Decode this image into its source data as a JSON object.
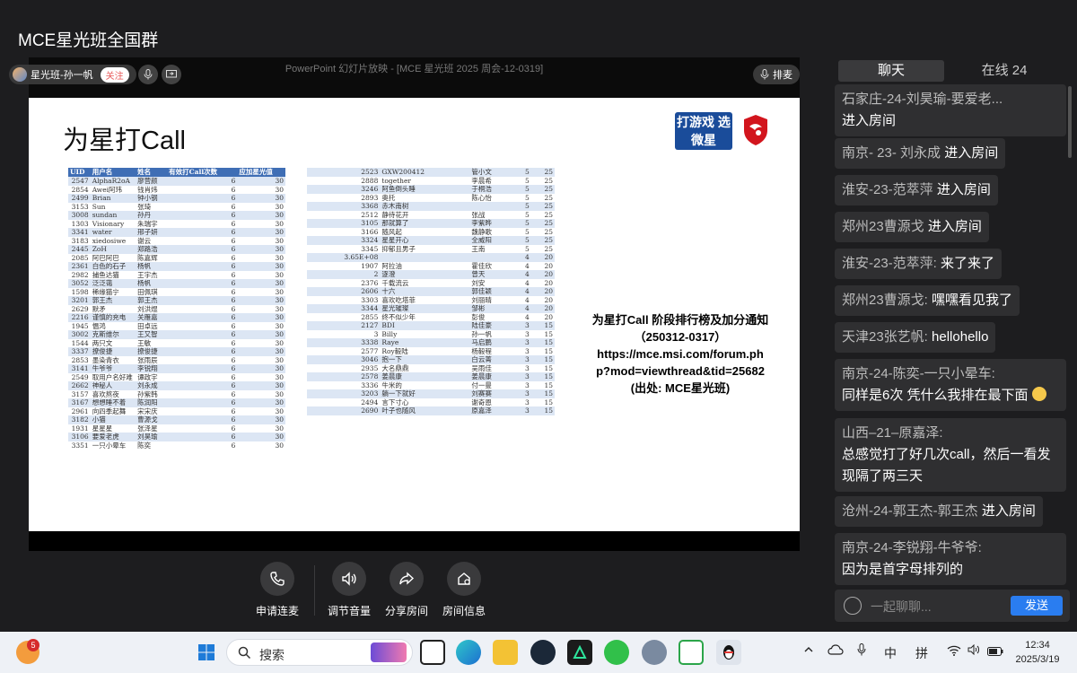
{
  "window": {
    "title": "MCE星光班全国群"
  },
  "stage": {
    "ppt_title": "PowerPoint 幻灯片放映 - [MCE 星光班 2025 周会-12-0319]",
    "host_name": "星光班-孙一帆",
    "follow_label": "关注",
    "queue_label": "排麦"
  },
  "slide": {
    "title": "为星打Call",
    "logo_text": "打游戏 选微星",
    "notice_lines": [
      "为星打Call 阶段排行榜及加分通知",
      "（250312-0317）",
      "https://mce.msi.com/forum.ph",
      "p?mod=viewthread&tid=25682",
      "(出处: MCE星光班)"
    ],
    "left_table": {
      "headers": [
        "UID",
        "用户名",
        "姓名",
        "有效打Call次数",
        "应加星光值"
      ],
      "rows": [
        [
          "2547",
          "AlphaR2oA",
          "廖营颜",
          "6",
          "30"
        ],
        [
          "2854",
          "Awei阿玮",
          "钱肖炜",
          "6",
          "30"
        ],
        [
          "2499",
          "Brian",
          "钟小钢",
          "6",
          "30"
        ],
        [
          "3153",
          "Sun",
          "张琦",
          "6",
          "30"
        ],
        [
          "3008",
          "sundan",
          "孙丹",
          "6",
          "30"
        ],
        [
          "1303",
          "Visionary",
          "朱瑞宇",
          "6",
          "30"
        ],
        [
          "3341",
          "water",
          "邢子妍",
          "6",
          "30"
        ],
        [
          "3183",
          "xiedosiwe",
          "谢云",
          "6",
          "30"
        ],
        [
          "2445",
          "ZoH",
          "郑路浩",
          "6",
          "30"
        ],
        [
          "2085",
          "阿巴阿巴",
          "陈嘉辉",
          "6",
          "30"
        ],
        [
          "2361",
          "白色的石子",
          "杨帆",
          "6",
          "30"
        ],
        [
          "2982",
          "捕鱼达猫",
          "王宇杰",
          "6",
          "30"
        ],
        [
          "3052",
          "泛泛蔼",
          "杨帆",
          "6",
          "30"
        ],
        [
          "1598",
          "稀缘猫宁",
          "田佩琪",
          "6",
          "30"
        ],
        [
          "3201",
          "郭王杰",
          "郭王杰",
          "6",
          "30"
        ],
        [
          "2629",
          "默矛",
          "刘洪煜",
          "6",
          "30"
        ],
        [
          "2216",
          "谨慎的充电",
          "关雁嘉",
          "6",
          "30"
        ],
        [
          "1945",
          "愠鸿",
          "田卓远",
          "6",
          "30"
        ],
        [
          "3002",
          "克斯维尔",
          "王又智",
          "6",
          "30"
        ],
        [
          "1544",
          "两只文",
          "王敏",
          "6",
          "30"
        ],
        [
          "3337",
          "撩俊捷",
          "撩俊捷",
          "6",
          "30"
        ],
        [
          "2853",
          "墨染青衣",
          "张雨辰",
          "6",
          "30"
        ],
        [
          "3141",
          "牛爷爷",
          "李锐翔",
          "6",
          "30"
        ],
        [
          "2549",
          "取用户名好难",
          "谭政宇",
          "6",
          "30"
        ],
        [
          "2662",
          "神秘人",
          "刘永成",
          "6",
          "30"
        ],
        [
          "3157",
          "喜欢熬夜",
          "孙紫韩",
          "6",
          "30"
        ],
        [
          "3167",
          "想想睡不着",
          "陈润阳",
          "6",
          "30"
        ],
        [
          "2961",
          "向四季起舞",
          "宋宋庆",
          "6",
          "30"
        ],
        [
          "3182",
          "小猫",
          "曹源戈",
          "6",
          "30"
        ],
        [
          "1931",
          "星星星",
          "张泽星",
          "6",
          "30"
        ],
        [
          "3106",
          "要爱老虎",
          "刘昊瑜",
          "6",
          "30"
        ],
        [
          "3351",
          "一只小晕车",
          "陈奕",
          "6",
          "30"
        ]
      ]
    },
    "right_table": {
      "rows": [
        [
          "2523",
          "GXW200412",
          "管小文",
          "5",
          "25"
        ],
        [
          "2888",
          "together",
          "李晨希",
          "5",
          "25"
        ],
        [
          "3246",
          "阿鱼倒头睡",
          "于桐浩",
          "5",
          "25"
        ],
        [
          "2893",
          "奥托",
          "陈心怡",
          "5",
          "25"
        ],
        [
          "3368",
          "赤木南树",
          "",
          "5",
          "25"
        ],
        [
          "2512",
          "静待花开",
          "张战",
          "5",
          "25"
        ],
        [
          "3105",
          "那就算了",
          "李紫晔",
          "5",
          "25"
        ],
        [
          "3166",
          "随风起",
          "魏静歌",
          "5",
          "25"
        ],
        [
          "3324",
          "星星开心",
          "全威阳",
          "5",
          "25"
        ],
        [
          "3345",
          "抑郁且男子",
          "王南",
          "5",
          "25"
        ],
        [
          "3.65E+08",
          "",
          "",
          "4",
          "20"
        ],
        [
          "1907",
          "阿拉油",
          "霍佳欣",
          "4",
          "20"
        ],
        [
          "2",
          "逐澄",
          "曾天",
          "4",
          "20"
        ],
        [
          "2376",
          "千载流云",
          "刘安",
          "4",
          "20"
        ],
        [
          "2606",
          "十六",
          "郭佳颖",
          "4",
          "20"
        ],
        [
          "3303",
          "喜欢吃塔菲",
          "刘丽晴",
          "4",
          "20"
        ],
        [
          "3344",
          "星光璀璨",
          "邹彬",
          "4",
          "20"
        ],
        [
          "2855",
          "终不似少年",
          "彭俊",
          "4",
          "20"
        ],
        [
          "2127",
          "BDI",
          "陆佳豪",
          "3",
          "15"
        ],
        [
          "3",
          "Billy",
          "孙一帆",
          "3",
          "15"
        ],
        [
          "3338",
          "Raye",
          "马启鹏",
          "3",
          "15"
        ],
        [
          "2577",
          "Roy毅陆",
          "杨毅程",
          "3",
          "15"
        ],
        [
          "3046",
          "抱一下",
          "白云菁",
          "3",
          "15"
        ],
        [
          "2935",
          "大名鼎鼎",
          "吴雨佳",
          "3",
          "15"
        ],
        [
          "2578",
          "姜晨康",
          "姜晨康",
          "3",
          "15"
        ],
        [
          "3336",
          "牛米的",
          "付一曼",
          "3",
          "15"
        ],
        [
          "3203",
          "躺一下就好",
          "刘赛赛",
          "3",
          "15"
        ],
        [
          "2494",
          "言下寸心",
          "谢奇恩",
          "3",
          "15"
        ],
        [
          "2690",
          "叶子也随风",
          "原嘉泽",
          "3",
          "15"
        ]
      ]
    }
  },
  "actions": [
    {
      "label": "申请连麦",
      "icon": "phone-icon"
    },
    {
      "label": "调节音量",
      "icon": "volume-icon"
    },
    {
      "label": "分享房间",
      "icon": "share-icon"
    },
    {
      "label": "房间信息",
      "icon": "room-info-icon"
    }
  ],
  "chat": {
    "tab_chat": "聊天",
    "tab_online": "在线 24",
    "input_placeholder": "一起聊聊...",
    "send_label": "发送",
    "messages": [
      {
        "name": "石家庄-24-刘昊瑜-要爱老...",
        "text": "进入房间"
      },
      {
        "name": "南京- 23-  刘永成",
        "text": "进入房间"
      },
      {
        "name": "淮安-23-范萃萍",
        "text": "进入房间"
      },
      {
        "name": "郑州23曹源戈",
        "text": "进入房间"
      },
      {
        "name": "淮安-23-范萃萍:",
        "text": "来了来了"
      },
      {
        "name": "郑州23曹源戈:",
        "text": "嘿嘿看见我了"
      },
      {
        "name": "天津23张艺帆:",
        "text": "hellohello"
      },
      {
        "name": "南京-24-陈奕-一只小晕车:",
        "text": "同样是6次 凭什么我排在最下面"
      },
      {
        "name": "山西–21–原嘉泽:",
        "text": "总感觉打了好几次call，然后一看发现隔了两三天"
      },
      {
        "name": "沧州-24-郭王杰-郭王杰",
        "text": "进入房间"
      },
      {
        "name": "南京-24-李锐翔-牛爷爷:",
        "text": "因为是首字母排列的"
      }
    ]
  },
  "taskbar": {
    "search_placeholder": "搜索",
    "notification_count": "5",
    "ime_mode": "中",
    "ime_layout": "拼",
    "time": "12:34",
    "date": "2025/3/19"
  }
}
